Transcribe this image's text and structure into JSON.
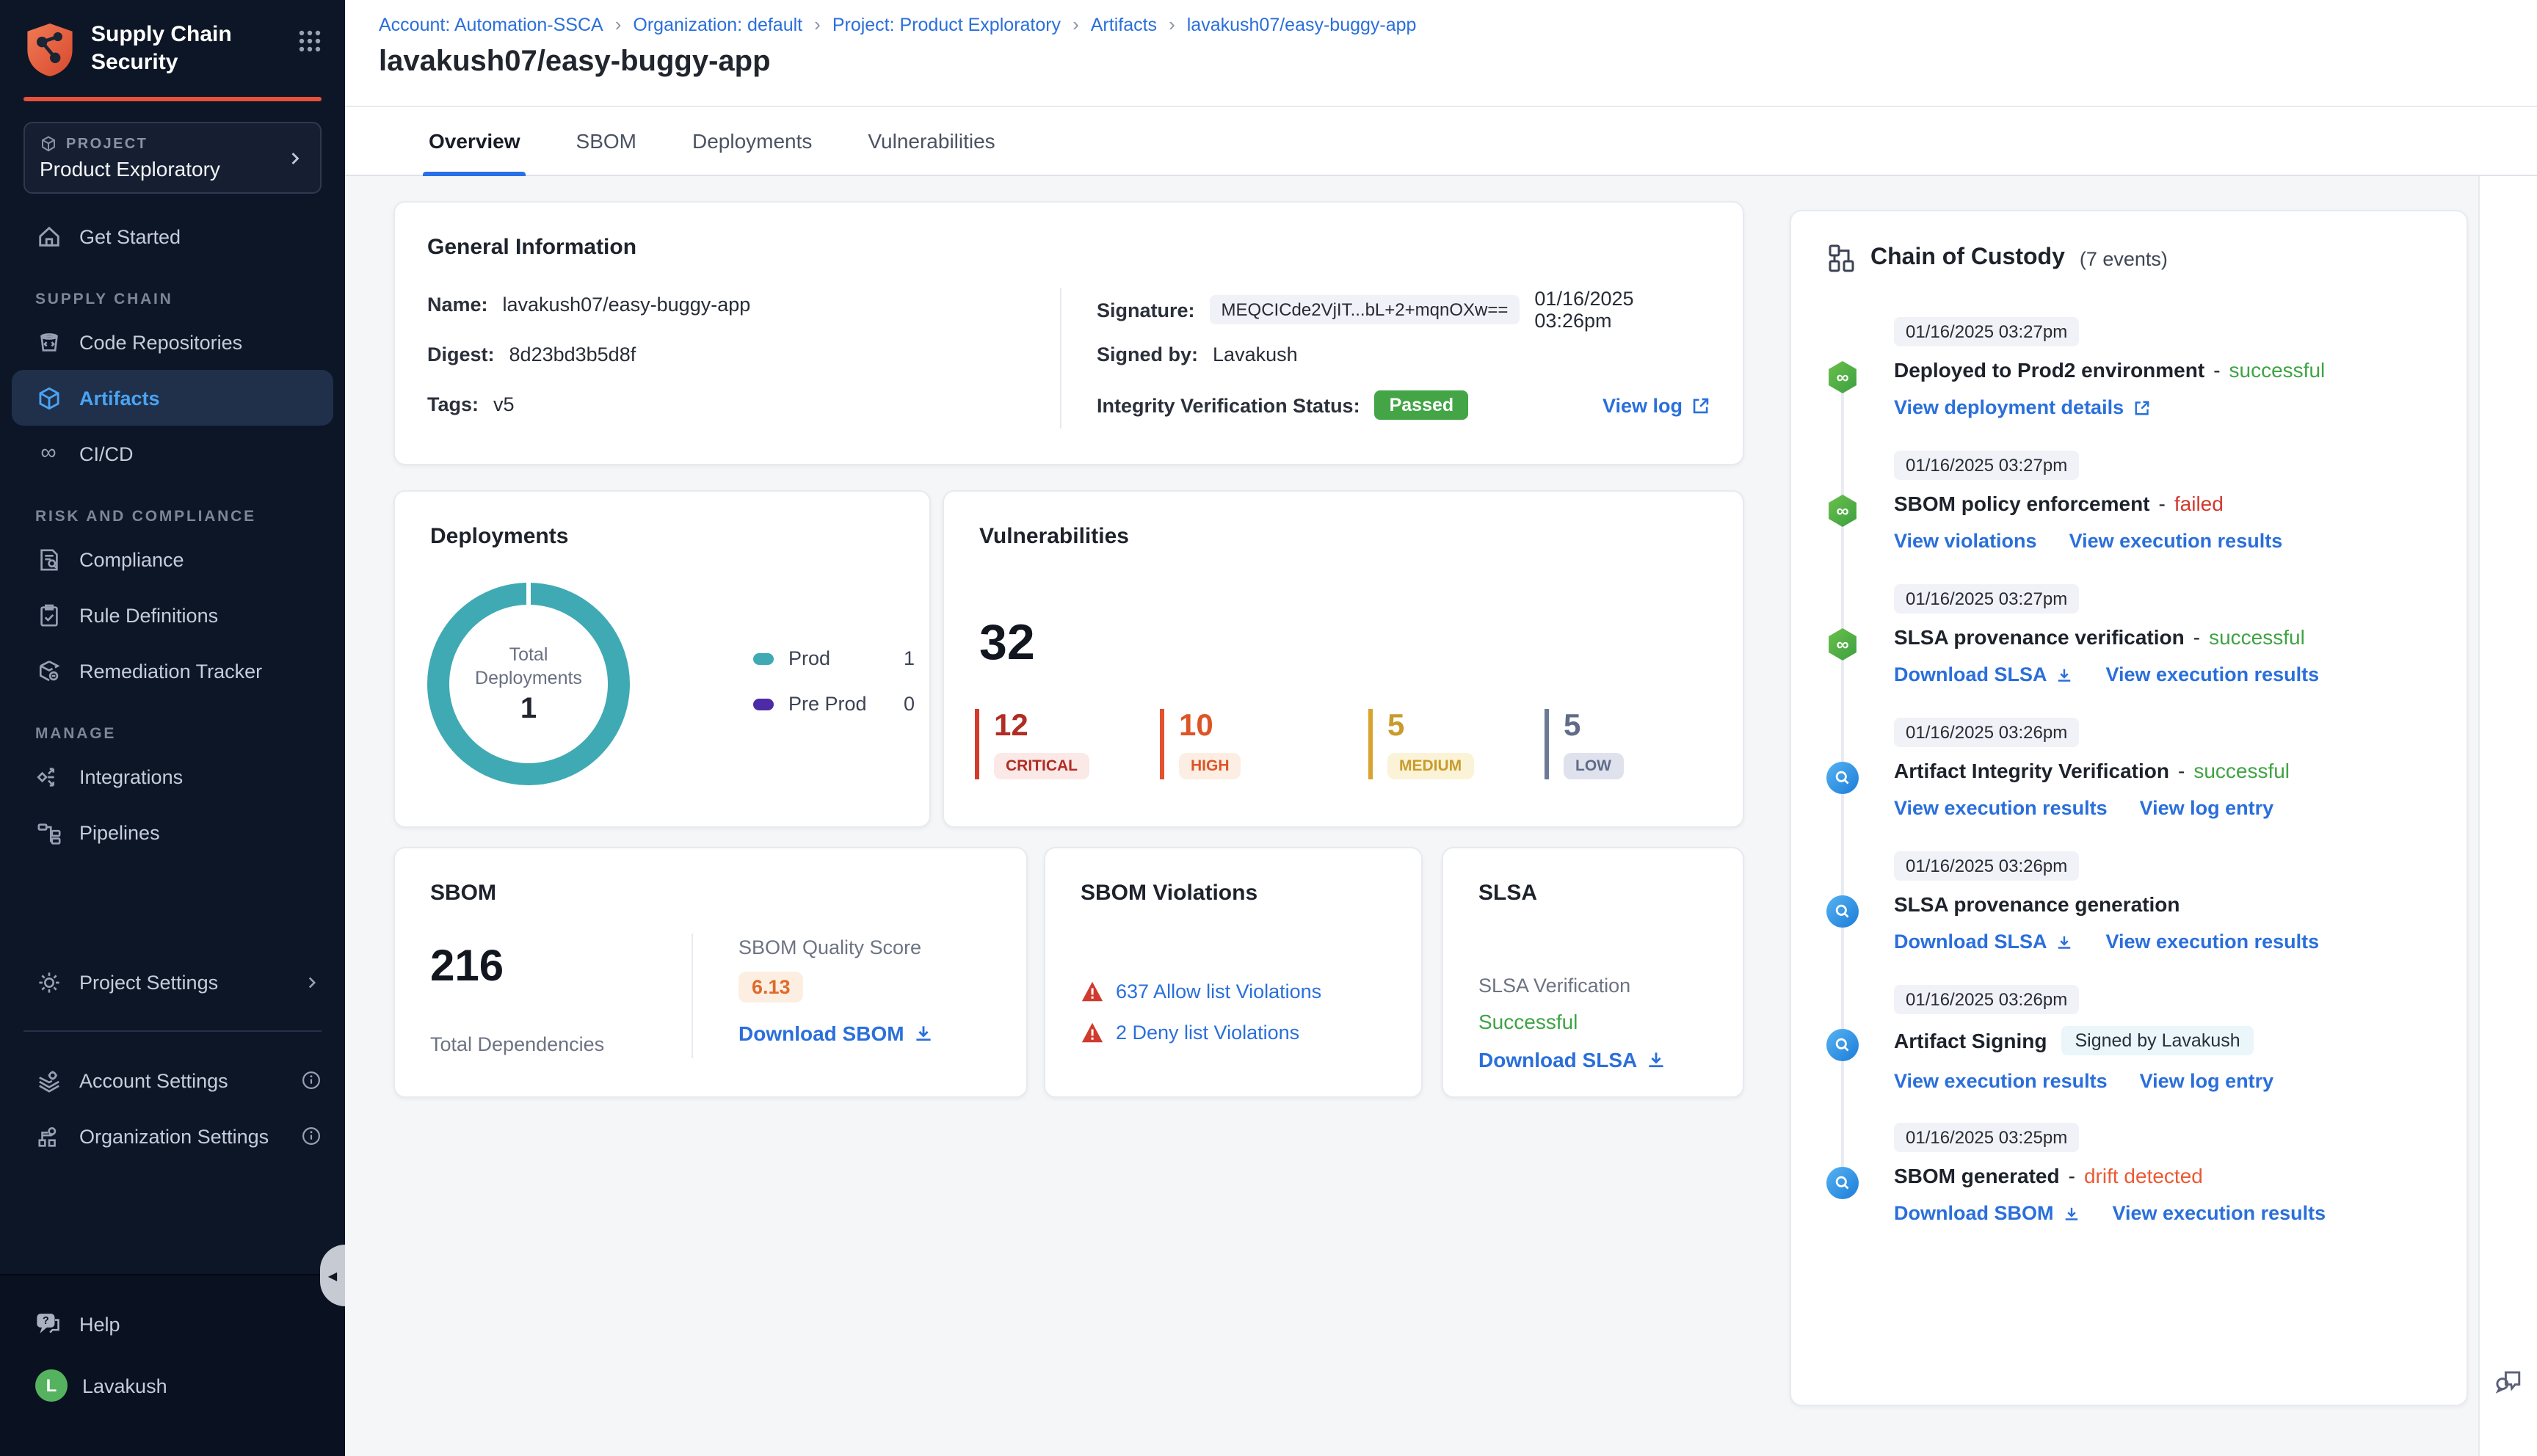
{
  "app": {
    "title": "Supply Chain Security"
  },
  "colors": {
    "accent_orange": "#e8503a",
    "link_blue": "#2a6fdb",
    "success_green": "#3fa345",
    "fail_red": "#d2392e",
    "drift_orange": "#ea5a33",
    "donut_teal": "#3faab4",
    "preprod_purple": "#4d2ba6",
    "critical": "#b02d24",
    "high": "#dd5426",
    "medium": "#c99b2b",
    "low": "#606c87",
    "passed_badge_green": "#43a546"
  },
  "sidebar": {
    "logo_title_line1": "Supply Chain",
    "logo_title_line2": "Security",
    "project_label": "PROJECT",
    "project_name": "Product Exploratory",
    "get_started": "Get Started",
    "supply_chain_label": "SUPPLY CHAIN",
    "code_repositories": "Code Repositories",
    "artifacts": "Artifacts",
    "cicd": "CI/CD",
    "risk_label": "RISK AND COMPLIANCE",
    "compliance": "Compliance",
    "rule_definitions": "Rule Definitions",
    "remediation_tracker": "Remediation Tracker",
    "manage_label": "MANAGE",
    "integrations": "Integrations",
    "pipelines": "Pipelines",
    "project_settings": "Project Settings",
    "account_settings": "Account Settings",
    "organization_settings": "Organization Settings",
    "help": "Help",
    "user_name": "Lavakush",
    "user_initial": "L"
  },
  "breadcrumb": {
    "sep": "›",
    "items": [
      "Account: Automation-SSCA",
      "Organization: default",
      "Project: Product Exploratory",
      "Artifacts",
      "lavakush07/easy-buggy-app"
    ]
  },
  "page_title": "lavakush07/easy-buggy-app",
  "tabs": {
    "overview": "Overview",
    "sbom": "SBOM",
    "deployments": "Deployments",
    "vulnerabilities": "Vulnerabilities"
  },
  "general_info": {
    "title": "General Information",
    "name_label": "Name:",
    "name": "lavakush07/easy-buggy-app",
    "digest_label": "Digest:",
    "digest": "8d23bd3b5d8f",
    "tags_label": "Tags:",
    "tags": "v5",
    "signature_label": "Signature:",
    "signature": "MEQCICde2VjIT...bL+2+mqnOXw==",
    "signature_time": "01/16/2025 03:26pm",
    "signed_by_label": "Signed by:",
    "signed_by": "Lavakush",
    "integrity_label": "Integrity Verification Status:",
    "integrity_status": "Passed",
    "view_log": "View log"
  },
  "deployments_card": {
    "title": "Deployments",
    "center_line1": "Total",
    "center_line2": "Deployments",
    "total": "1",
    "legend": [
      {
        "label": "Prod",
        "value": "1",
        "color": "#3faab4"
      },
      {
        "label": "Pre Prod",
        "value": "0",
        "color": "#4d2ba6"
      }
    ]
  },
  "vulnerabilities_card": {
    "title": "Vulnerabilities",
    "total": "32",
    "stats": [
      {
        "count": "12",
        "label": "CRITICAL"
      },
      {
        "count": "10",
        "label": "HIGH"
      },
      {
        "count": "5",
        "label": "MEDIUM"
      },
      {
        "count": "5",
        "label": "LOW"
      }
    ]
  },
  "sbom_card": {
    "title": "SBOM",
    "total": "216",
    "total_label": "Total Dependencies",
    "score_label": "SBOM Quality Score",
    "score": "6.13",
    "download": "Download SBOM"
  },
  "violations_card": {
    "title": "SBOM Violations",
    "allow_link": "637 Allow list Violations",
    "deny_link": "2 Deny list Violations"
  },
  "slsa_card": {
    "title": "SLSA",
    "verification_label": "SLSA Verification",
    "status": "Successful",
    "download": "Download SLSA"
  },
  "chain": {
    "title": "Chain of Custody",
    "count": "(7 events)",
    "dash": "-",
    "events": [
      {
        "time": "01/16/2025 03:27pm",
        "title": "Deployed to Prod2 environment",
        "status": "successful",
        "links": [
          {
            "label": "View deployment details"
          }
        ]
      },
      {
        "time": "01/16/2025 03:27pm",
        "title": "SBOM policy enforcement",
        "status": "failed",
        "links": [
          {
            "label": "View violations"
          },
          {
            "label": "View execution results"
          }
        ]
      },
      {
        "time": "01/16/2025 03:27pm",
        "title": "SLSA provenance verification",
        "status": "successful",
        "links": [
          {
            "label": "Download SLSA"
          },
          {
            "label": "View execution results"
          }
        ]
      },
      {
        "time": "01/16/2025 03:26pm",
        "title": "Artifact Integrity Verification",
        "status": "successful",
        "links": [
          {
            "label": "View execution results"
          },
          {
            "label": "View log entry"
          }
        ]
      },
      {
        "time": "01/16/2025 03:26pm",
        "title": "SLSA provenance generation",
        "links": [
          {
            "label": "Download SLSA"
          },
          {
            "label": "View execution results"
          }
        ]
      },
      {
        "time": "01/16/2025 03:26pm",
        "title": "Artifact Signing",
        "badge": "Signed by Lavakush",
        "links": [
          {
            "label": "View execution results"
          },
          {
            "label": "View log entry"
          }
        ]
      },
      {
        "time": "01/16/2025 03:25pm",
        "title": "SBOM generated",
        "status": "drift detected",
        "links": [
          {
            "label": "Download SBOM"
          },
          {
            "label": "View execution results"
          }
        ]
      }
    ]
  }
}
